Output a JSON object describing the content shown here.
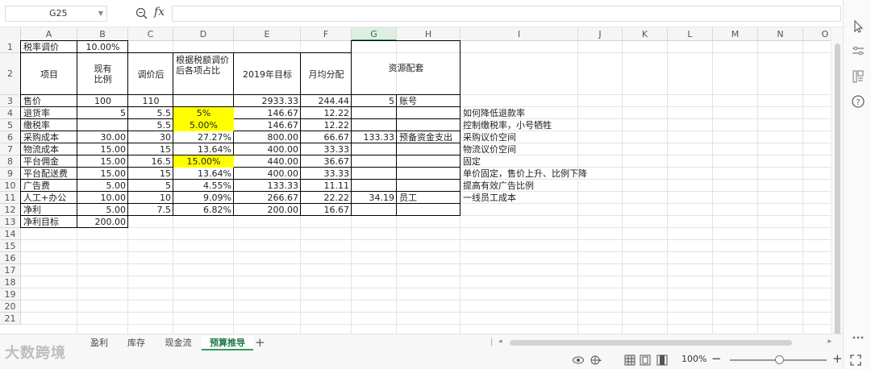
{
  "formula_bar": {
    "name_box": "G25",
    "fx_label": "fx",
    "formula": ""
  },
  "columns": [
    "A",
    "B",
    "C",
    "D",
    "E",
    "F",
    "G",
    "H",
    "I",
    "J",
    "K",
    "L",
    "M",
    "N",
    "O"
  ],
  "selected_column": "G",
  "rows": [
    "1",
    "2",
    "3",
    "4",
    "5",
    "6",
    "7",
    "8",
    "9",
    "10",
    "11",
    "12",
    "13",
    "14",
    "15",
    "16",
    "17",
    "18",
    "19",
    "20",
    "21"
  ],
  "cells": {
    "A1": "税率调价",
    "B1": "10.00%",
    "A2": "项目",
    "B2": "现有\n比例",
    "C2": "调价后",
    "D2": "根据税额调价后各项占比",
    "E2": "2019年目标",
    "F2": "月均分配",
    "G2": "资源配套",
    "A3": "售价",
    "B3": "100",
    "C3": "110",
    "E3": "2933.33",
    "F3": "244.44",
    "G3": "5",
    "H3": "账号",
    "A4": "退货率",
    "B4": "5",
    "C4": "5.5",
    "D4": "5%",
    "E4": "146.67",
    "F4": "12.22",
    "I4": "如何降低退款率",
    "A5": "缴税率",
    "C5": "5.5",
    "D5": "5.00%",
    "E5": "146.67",
    "F5": "12.22",
    "I5": "控制缴税率，小号牺牲",
    "A6": "采购成本",
    "B6": "30.00",
    "C6": "30",
    "D6": "27.27%",
    "E6": "800.00",
    "F6": "66.67",
    "G6": "133.33",
    "H6": "预备资金支出",
    "I6": "采购议价空间",
    "A7": "物流成本",
    "B7": "15.00",
    "C7": "15",
    "D7": "13.64%",
    "E7": "400.00",
    "F7": "33.33",
    "I7": "物流议价空间",
    "A8": "平台佣金",
    "B8": "15.00",
    "C8": "16.5",
    "D8": "15.00%",
    "E8": "440.00",
    "F8": "36.67",
    "I8": "固定",
    "A9": "平台配送费",
    "B9": "15.00",
    "C9": "15",
    "D9": "13.64%",
    "E9": "400.00",
    "F9": "33.33",
    "I9": "单价固定，售价上升、比例下降",
    "A10": "广告费",
    "B10": "5.00",
    "C10": "5",
    "D10": "4.55%",
    "E10": "133.33",
    "F10": "11.11",
    "I10": "提高有效广告比例",
    "A11": "人工+办公",
    "B11": "10.00",
    "C11": "10",
    "D11": "9.09%",
    "E11": "266.67",
    "F11": "22.22",
    "G11": "34.19",
    "H11": "员工",
    "I11": "一线员工成本",
    "A12": "净利",
    "B12": "5.00",
    "C12": "7.5",
    "D12": "6.82%",
    "E12": "200.00",
    "F12": "16.67",
    "A13": "净利目标",
    "B13": "200.00"
  },
  "highlight_color": "#ffff00",
  "sheet_tabs": [
    "盈利",
    "库存",
    "现金流",
    "预算推导"
  ],
  "active_tab": "预算推导",
  "status": {
    "zoom": "100%",
    "watermark": "大数跨境"
  },
  "accent_color": "#2e9b5b",
  "icons": {
    "formula": [
      "zoom-function-icon"
    ],
    "right_panel": [
      "select-cursor-icon",
      "properties-icon",
      "format-icon",
      "help-icon",
      "more-icon"
    ],
    "status": [
      "eye-protection-icon",
      "layout-center-icon",
      "normal-view-icon",
      "page-layout-icon",
      "page-break-icon",
      "fullscreen-icon"
    ]
  }
}
